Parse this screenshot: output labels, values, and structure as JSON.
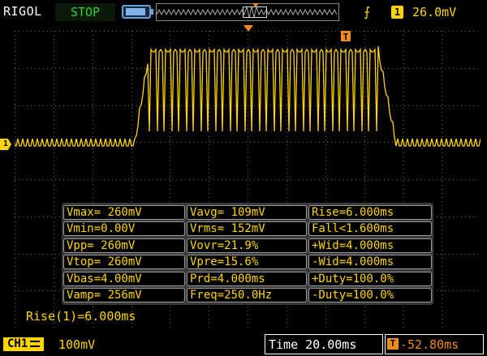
{
  "header": {
    "brand": "RIGOL",
    "run_state": "STOP",
    "trigger": {
      "edge_icon": "rising-edge-icon",
      "channel": "1",
      "level": "26.0mV"
    }
  },
  "measurements": [
    [
      "Vmax= 260mV",
      "Vavg= 109mV",
      "Rise=6.000ms"
    ],
    [
      "Vmin=0.00V",
      "Vrms= 152mV",
      "Fall<1.600ms"
    ],
    [
      "Vpp= 260mV",
      "Vovr=21.9%",
      "+Wid=4.000ms"
    ],
    [
      "Vtop= 260mV",
      "Vpre=15.6%",
      "-Wid=4.000ms"
    ],
    [
      "Vbas=4.00mV",
      "Prd=4.000ms",
      "+Duty=100.0%"
    ],
    [
      "Vamp= 256mV",
      "Freq=250.0Hz",
      "-Duty=100.0%"
    ]
  ],
  "cursor_readout": "Rise(1)=6.000ms",
  "footer": {
    "channel_label": "CH1",
    "volts_per_div": "100mV",
    "timebase": "Time 20.00ms",
    "trigger_offset": "-52.80ms"
  },
  "markers": {
    "channel_marker": "1",
    "trigger_marker": "T"
  },
  "colors": {
    "trace": "#ffd400",
    "grid": "#6b6b6b",
    "trigger_marker": "#f08a1a",
    "run_state": "#27d627"
  }
}
